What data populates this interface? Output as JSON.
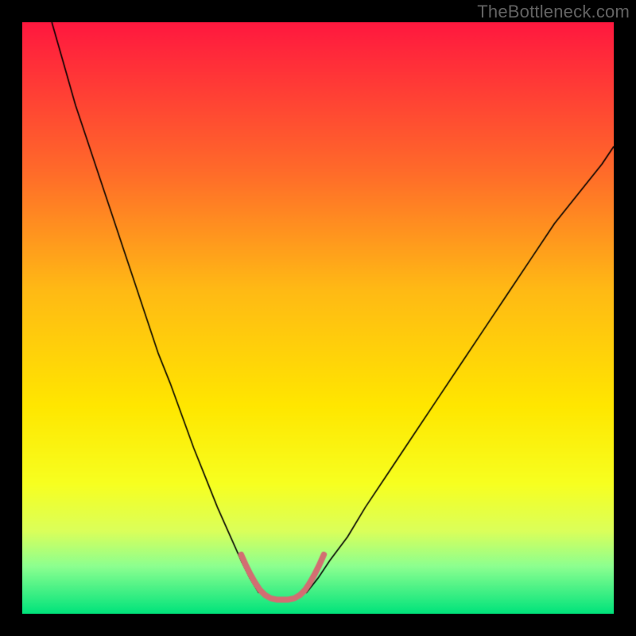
{
  "watermark": "TheBottleneck.com",
  "colors": {
    "frame": "#000000",
    "gradient_top": "#ff183f",
    "gradient_mid": "#ffe700",
    "gradient_bottom": "#00e37b",
    "curve": "#000000",
    "marker": "#d26e72"
  },
  "chart_data": {
    "type": "line",
    "title": "",
    "xlabel": "",
    "ylabel": "",
    "xlim": [
      0,
      100
    ],
    "ylim": [
      0,
      100
    ],
    "gradient_stops": [
      {
        "pos": 0.0,
        "color": "#ff183f"
      },
      {
        "pos": 0.25,
        "color": "#ff6a2a"
      },
      {
        "pos": 0.45,
        "color": "#ffb915"
      },
      {
        "pos": 0.65,
        "color": "#ffe700"
      },
      {
        "pos": 0.78,
        "color": "#f7ff20"
      },
      {
        "pos": 0.86,
        "color": "#dbff5a"
      },
      {
        "pos": 0.92,
        "color": "#8cff90"
      },
      {
        "pos": 1.0,
        "color": "#00e37b"
      }
    ],
    "series": [
      {
        "name": "left-limb",
        "stroke": "#000000",
        "width": 1.6,
        "x": [
          5,
          7,
          9,
          11,
          13,
          15,
          17,
          19,
          21,
          23,
          25,
          27,
          29,
          31,
          33,
          35,
          37,
          38.5,
          40
        ],
        "y": [
          100,
          93,
          86,
          80,
          74,
          68,
          62,
          56,
          50,
          44,
          39,
          33.5,
          28,
          23,
          18,
          13.5,
          9,
          6,
          3.5
        ]
      },
      {
        "name": "right-limb",
        "stroke": "#000000",
        "width": 1.6,
        "x": [
          48,
          50,
          52,
          55,
          58,
          62,
          66,
          70,
          74,
          78,
          82,
          86,
          90,
          94,
          98,
          100
        ],
        "y": [
          3.5,
          6,
          9,
          13,
          18,
          24,
          30,
          36,
          42,
          48,
          54,
          60,
          66,
          71,
          76,
          79
        ]
      },
      {
        "name": "trough-highlight",
        "stroke": "#d26e72",
        "width": 7.5,
        "cap": "round",
        "x": [
          37.0,
          37.8,
          38.6,
          39.4,
          40.2,
          41.0,
          42.0,
          43.0,
          44.0,
          45.0,
          46.0,
          47.0,
          47.8,
          48.6,
          49.4,
          50.2,
          51.0
        ],
        "y": [
          10.0,
          8.2,
          6.6,
          5.2,
          4.0,
          3.2,
          2.6,
          2.4,
          2.4,
          2.4,
          2.6,
          3.2,
          4.0,
          5.2,
          6.6,
          8.2,
          10.0
        ]
      }
    ]
  }
}
